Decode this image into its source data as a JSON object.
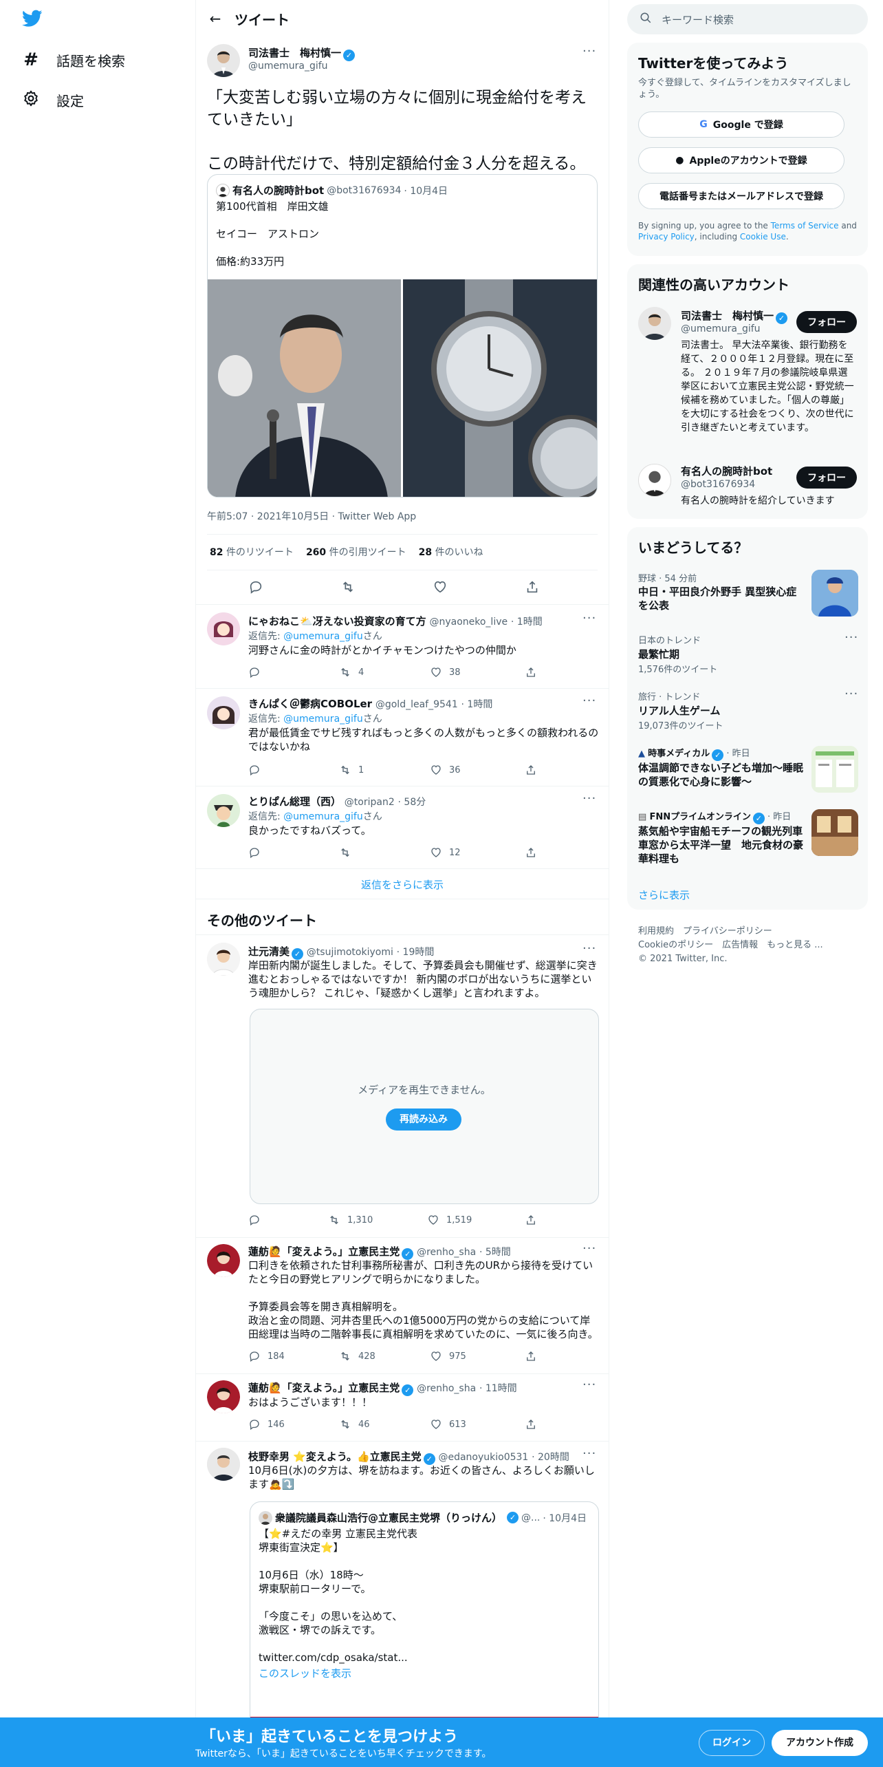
{
  "nav": {
    "explore": "話題を検索",
    "settings": "設定"
  },
  "header": {
    "title": "ツイート"
  },
  "main_tweet": {
    "name": "司法書士　梅村慎一",
    "handle": "@umemura_gifu",
    "text": "「大変苦しむ弱い立場の方々に個別に現金給付を考えていきたい」\n\nこの時計代だけで、特別定額給付金３人分を超える。",
    "quote": {
      "name": "有名人の腕時計bot",
      "handle": "@bot31676934",
      "date": "· 10月4日",
      "text": "第100代首相　岸田文雄\n\nセイコー　アストロン\n\n価格:約33万円"
    },
    "meta": "午前5:07 · 2021年10月5日 · Twitter Web App",
    "retweets_count": "82",
    "retweets_label": "件のリツイート",
    "quotes_count": "260",
    "quotes_label": "件の引用ツイート",
    "likes_count": "28",
    "likes_label": "件のいいね"
  },
  "replies": [
    {
      "name": "にゃおねこ⛅冴えない投資家の育て方",
      "handle": "@nyaoneko_live",
      "time": "· 1時間",
      "reply_prefix": "返信先: ",
      "reply_to": "@umemura_gifu",
      "reply_suffix": "さん",
      "text": "河野さんに金の時計がとかイチャモンつけたやつの仲間か",
      "rt": "4",
      "likes": "38"
    },
    {
      "name": "きんぱく＠鬱病COBOLer",
      "handle": "@gold_leaf_9541",
      "time": "· 1時間",
      "reply_prefix": "返信先: ",
      "reply_to": "@umemura_gifu",
      "reply_suffix": "さん",
      "text": "君が最低賃金でサビ残すればもっと多くの人数がもっと多くの額救われるのではないかね",
      "rt": "1",
      "likes": "36"
    },
    {
      "name": "とりぱん総理（西）",
      "handle": "@toripan2",
      "time": "· 58分",
      "reply_prefix": "返信先: ",
      "reply_to": "@umemura_gifu",
      "reply_suffix": "さん",
      "text": "良かったですねバズって。",
      "rt": "",
      "likes": "12"
    }
  ],
  "show_more_replies": "返信をさらに表示",
  "other_tweets_title": "その他のツイート",
  "others": [
    {
      "name": "辻元清美",
      "handle": "@tsujimotokiyomi",
      "time": "· 19時間",
      "text": "岸田新内閣が誕生しました。そして、予算委員会も開催せず、総選挙に突き進むとおっしゃるではないですか！ 新内閣のボロが出ないうちに選挙という魂胆かしら？ これじゃ、「疑惑かくし選挙」と言われますよ。",
      "media_error": "メディアを再生できません。",
      "reload": "再読み込み",
      "replies": "",
      "rt": "1,310",
      "likes": "1,519"
    },
    {
      "name": "蓮舫🙋「変えよう。」立憲民主党",
      "handle": "@renho_sha",
      "time": "· 5時間",
      "text": "口利きを依頼された甘利事務所秘書が、口利き先のURから接待を受けていたと今日の野党ヒアリングで明らかになりました。\n\n予算委員会等を開き真相解明を。\n政治と金の問題、河井杏里氏への1億5000万円の党からの支給について岸田総理は当時の二階幹事長に真相解明を求めていたのに、一気に後ろ向き。",
      "replies": "184",
      "rt": "428",
      "likes": "975"
    },
    {
      "name": "蓮舫🙋「変えよう。」立憲民主党",
      "handle": "@renho_sha",
      "time": "· 11時間",
      "text": "おはようございます！！！",
      "replies": "146",
      "rt": "46",
      "likes": "613"
    },
    {
      "name": "枝野幸男 ⭐変えよう。👍立憲民主党",
      "handle": "@edanoyukio0531",
      "time": "· 20時間",
      "text": "10月6日(水)の夕方は、堺を訪ねます。お近くの皆さん、よろしくお願いします🙇⤵️"
    }
  ],
  "last_quote": {
    "name": "衆議院議員森山浩行@立憲民主党堺（りっけん）",
    "handle": "@...",
    "date": "· 10月4日",
    "text": "【⭐#えだの幸男 立憲民主党代表\n堺東街宣決定⭐】\n\n10月6日（水）18時〜\n堺東駅前ロータリーで。\n\n「今度こそ」の思いを込めて、\n激戦区・堺での訴えです。\n\ntwitter.com/cdp_osaka/stat...",
    "thread": "このスレッドを表示"
  },
  "right": {
    "search_placeholder": "キーワード検索",
    "signup_title": "Twitterを使ってみよう",
    "signup_sub": "今すぐ登録して、タイムラインをカスタマイズしましょう。",
    "google": "Google で登録",
    "apple": "Appleのアカウントで登録",
    "phone": "電話番号またはメールアドレスで登録",
    "terms_1": "By signing up, you agree to the ",
    "terms_link1": "Terms of Service",
    "terms_2": " and ",
    "terms_link2": "Privacy Policy",
    "terms_3": ", including ",
    "terms_link3": "Cookie Use",
    "terms_4": ".",
    "related_title": "関連性の高いアカウント",
    "follow": "フォロー",
    "acc1_name": "司法書士　梅村慎一",
    "acc1_handle": "@umemura_gifu",
    "acc1_bio": "司法書士。 早大法卒業後、銀行勤務を経て、２０００年１２月登録。現在に至る。 ２０１９年７月の参議院岐阜県選挙区において立憲民主党公認・野党統一候補を務めていました。「個人の尊厳」を大切にする社会をつくり、次の世代に引き継ぎたいと考えています。",
    "acc2_name": "有名人の腕時計bot",
    "acc2_handle": "@bot31676934",
    "acc2_bio": "有名人の腕時計を紹介していきます",
    "trends_title": "いまどうしてる？",
    "trends": [
      {
        "meta": "野球 · 54 分前",
        "title": "中日・平田良介外野手 異型狭心症を公表",
        "count": ""
      },
      {
        "meta": "日本のトレンド",
        "title": "最繁忙期",
        "count": "1,576件のツイート"
      },
      {
        "meta": "旅行 · トレンド",
        "title": "リアル人生ゲーム",
        "count": "19,073件のツイート"
      },
      {
        "meta": "時事メディカル",
        "meta2": "· 昨日",
        "title": "体温調節できない子ども増加～睡眠の質悪化で心身に影響～",
        "count": ""
      },
      {
        "meta": "FNNプライムオンライン",
        "meta2": "· 昨日",
        "title": "蒸気船や宇宙船モチーフの観光列車　車窓から太平洋一望　地元食材の豪華料理も",
        "count": ""
      }
    ],
    "show_more": "さらに表示",
    "footer_1": "利用規約　プライバシーポリシー",
    "footer_2": "Cookieのポリシー　広告情報　もっと見る ...",
    "footer_3": "© 2021 Twitter, Inc."
  },
  "bottom": {
    "title": "「いま」起きていることを見つけよう",
    "sub": "Twitterなら、「いま」起きていることをいち早くチェックできます。",
    "login": "ログイン",
    "signup": "アカウント作成"
  },
  "colors": {
    "accent": "#1d9bf0",
    "text": "#0f1419",
    "muted": "#536471"
  }
}
